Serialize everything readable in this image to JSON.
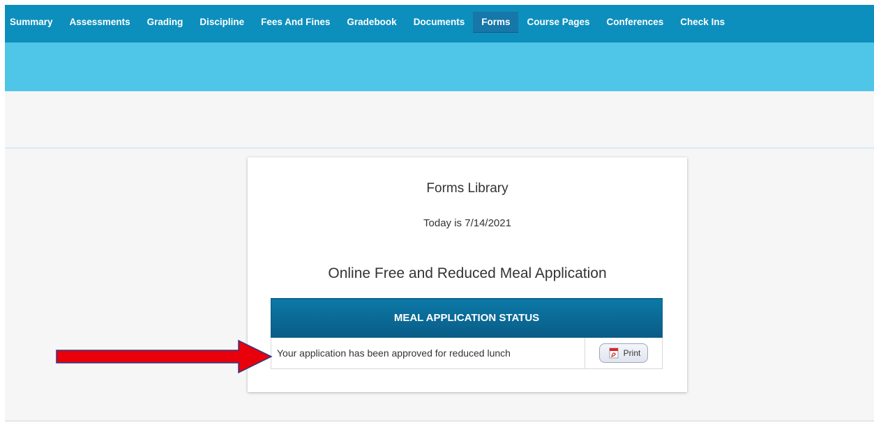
{
  "nav": {
    "items": [
      {
        "label": "Summary"
      },
      {
        "label": "Assessments"
      },
      {
        "label": "Grading"
      },
      {
        "label": "Discipline"
      },
      {
        "label": "Fees And Fines"
      },
      {
        "label": "Gradebook"
      },
      {
        "label": "Documents"
      },
      {
        "label": "Forms"
      },
      {
        "label": "Course Pages"
      },
      {
        "label": "Conferences"
      },
      {
        "label": "Check Ins"
      }
    ],
    "active": "Forms"
  },
  "forms": {
    "title": "Forms Library",
    "date_text": "Today is 7/14/2021",
    "application_title": "Online Free and Reduced Meal Application",
    "table": {
      "header": "MEAL APPLICATION STATUS",
      "status_message": "Your application has been approved for reduced lunch",
      "print_label": "Print",
      "print_icon": "pdf-icon"
    }
  },
  "annotation": {
    "arrow_color": "#e8000b",
    "arrow_outline": "#2b3a8c"
  },
  "colors": {
    "nav_bg": "#0d8fbd",
    "subbar_bg": "#4fc5e7",
    "table_header_bg": "#0a6a97"
  }
}
